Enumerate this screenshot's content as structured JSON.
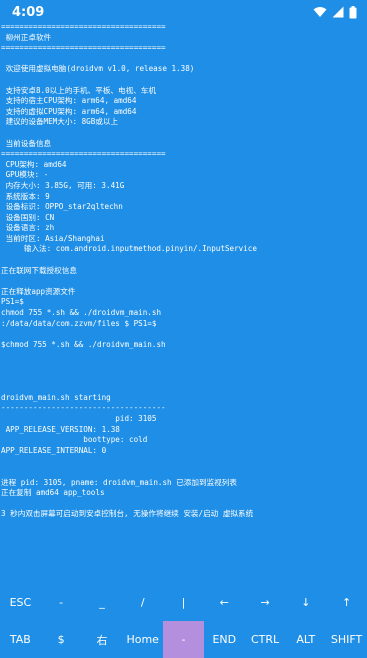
{
  "status_bar": {
    "time": "4:09",
    "icons": [
      "wifi-icon",
      "signal-icon",
      "battery-icon"
    ]
  },
  "terminal": {
    "lines": [
      "====================================",
      " 柳州正卓软件",
      "====================================",
      "",
      " 欢迎使用虚拟电脑(droidvm v1.0, release 1.38)",
      "",
      " 支持安卓8.0以上的手机、平板、电视、车机",
      " 支持的宿主CPU架构: arm64, amd64",
      " 支持的虚拟CPU架构: arm64, amd64",
      " 建议的设备MEM大小: 8GB或以上",
      "",
      " 当前设备信息",
      "====================================",
      " CPU架构: amd64",
      " GPU模块: -",
      " 内存大小: 3.85G, 可用: 3.41G",
      " 系统版本: 9",
      " 设备标识: OPPO_star2qltechn",
      " 设备国别: CN",
      " 设备语言: zh",
      " 当前时区: Asia/Shanghai",
      "     输入法: com.android.inputmethod.pinyin/.InputService",
      "",
      "正在联网下载授权信息",
      "",
      "正在释放app资源文件",
      "PS1=$",
      "chmod 755 *.sh && ./droidvm_main.sh",
      ":/data/data/com.zzvm/files $ PS1=$",
      "",
      "$chmod 755 *.sh && ./droidvm_main.sh",
      "",
      "",
      "",
      "",
      "droidvm_main.sh starting",
      "------------------------------------",
      "                         pid: 3105",
      " APP_RELEASE_VERSION: 1.38",
      "                  boottype: cold",
      "APP_RELEASE_INTERNAL: 0",
      "",
      "",
      "进程 pid: 3105, pname: droidvm_main.sh 已添加到监视列表",
      "正在复制 amd64 app_tools",
      "",
      "3 秒内双击屏幕可启动到安卓控制台, 无操作将继续 安装/启动 虚拟系统"
    ]
  },
  "extra_keys": {
    "row1": [
      "ESC",
      "-",
      "_",
      "/",
      "|",
      "←",
      "→",
      "↓",
      "↑"
    ],
    "row2": [
      "TAB",
      "$",
      "右",
      "Home",
      "-",
      "END",
      "CTRL",
      "ALT",
      "SHIFT"
    ],
    "active_key": "-",
    "active_color": "#b48fde"
  },
  "colors": {
    "background": "#1e8ee6",
    "text": "#ffffff"
  }
}
